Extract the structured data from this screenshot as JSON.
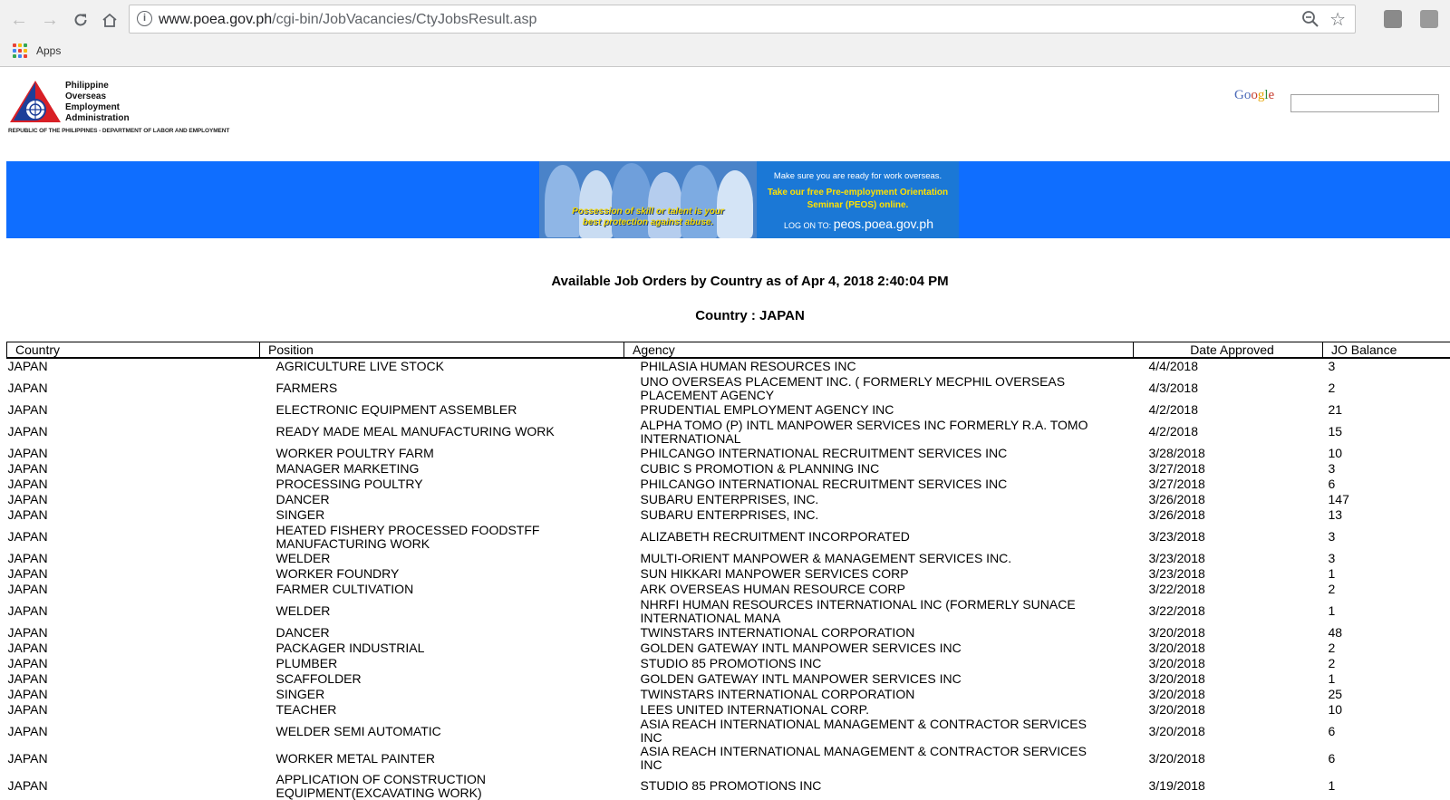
{
  "browser": {
    "url_host": "www.poea.gov.ph",
    "url_path": "/cgi-bin/JobVacancies/CtyJobsResult.asp",
    "bookmarks": [
      {
        "label": "Apps"
      }
    ]
  },
  "header": {
    "logo_lines": [
      "Philippine",
      "Overseas",
      "Employment",
      "Administration"
    ],
    "logo_subtitle": "REPUBLIC OF THE PHILIPPINES - DEPARTMENT OF LABOR AND EMPLOYMENT",
    "search_label": "Google",
    "search_value": ""
  },
  "banner": {
    "caption": "Possession of skill or talent is your best protection against abuse.",
    "line1": "Make sure you are ready for work overseas.",
    "line2": "Take our free Pre-employment Orientation Seminar (PEOS) online.",
    "logon_prefix": "LOG ON TO:",
    "logon_site": "peos.poea.gov.ph"
  },
  "page": {
    "title": "Available Job Orders by Country as of Apr 4, 2018 2:40:04 PM",
    "country_heading": "Country : JAPAN"
  },
  "table": {
    "headers": [
      "Country",
      "Position",
      "Agency",
      "Date Approved",
      "JO Balance"
    ],
    "rows": [
      {
        "country": "JAPAN",
        "position": "AGRICULTURE LIVE STOCK",
        "agency": "PHILASIA HUMAN RESOURCES INC",
        "date": "4/4/2018",
        "balance": "3"
      },
      {
        "country": "JAPAN",
        "position": "FARMERS",
        "agency": "UNO OVERSEAS PLACEMENT INC. ( FORMERLY MECPHIL OVERSEAS PLACEMENT AGENCY",
        "date": "4/3/2018",
        "balance": "2"
      },
      {
        "country": "JAPAN",
        "position": "ELECTRONIC EQUIPMENT ASSEMBLER",
        "agency": "PRUDENTIAL EMPLOYMENT AGENCY INC",
        "date": "4/2/2018",
        "balance": "21"
      },
      {
        "country": "JAPAN",
        "position": "READY MADE MEAL MANUFACTURING WORK",
        "agency": "ALPHA TOMO (P) INTL MANPOWER SERVICES INC FORMERLY R.A. TOMO INTERNATIONAL",
        "date": "4/2/2018",
        "balance": "15"
      },
      {
        "country": "JAPAN",
        "position": "WORKER POULTRY FARM",
        "agency": "PHILCANGO INTERNATIONAL RECRUITMENT SERVICES INC",
        "date": "3/28/2018",
        "balance": "10"
      },
      {
        "country": "JAPAN",
        "position": "MANAGER MARKETING",
        "agency": "CUBIC S PROMOTION & PLANNING INC",
        "date": "3/27/2018",
        "balance": "3"
      },
      {
        "country": "JAPAN",
        "position": "PROCESSING POULTRY",
        "agency": "PHILCANGO INTERNATIONAL RECRUITMENT SERVICES INC",
        "date": "3/27/2018",
        "balance": "6"
      },
      {
        "country": "JAPAN",
        "position": "DANCER",
        "agency": "SUBARU ENTERPRISES, INC.",
        "date": "3/26/2018",
        "balance": "147"
      },
      {
        "country": "JAPAN",
        "position": "SINGER",
        "agency": "SUBARU ENTERPRISES, INC.",
        "date": "3/26/2018",
        "balance": "13"
      },
      {
        "country": "JAPAN",
        "position": "HEATED FISHERY PROCESSED FOODSTFF MANUFACTURING WORK",
        "agency": "ALIZABETH RECRUITMENT INCORPORATED",
        "date": "3/23/2018",
        "balance": "3"
      },
      {
        "country": "JAPAN",
        "position": "WELDER",
        "agency": "MULTI-ORIENT MANPOWER & MANAGEMENT SERVICES INC.",
        "date": "3/23/2018",
        "balance": "3"
      },
      {
        "country": "JAPAN",
        "position": "WORKER FOUNDRY",
        "agency": "SUN HIKKARI MANPOWER SERVICES CORP",
        "date": "3/23/2018",
        "balance": "1"
      },
      {
        "country": "JAPAN",
        "position": "FARMER CULTIVATION",
        "agency": "ARK OVERSEAS HUMAN RESOURCE CORP",
        "date": "3/22/2018",
        "balance": "2"
      },
      {
        "country": "JAPAN",
        "position": "WELDER",
        "agency": "NHRFI HUMAN RESOURCES INTERNATIONAL INC (FORMERLY SUNACE INTERNATIONAL MANA",
        "date": "3/22/2018",
        "balance": "1"
      },
      {
        "country": "JAPAN",
        "position": "DANCER",
        "agency": "TWINSTARS INTERNATIONAL CORPORATION",
        "date": "3/20/2018",
        "balance": "48"
      },
      {
        "country": "JAPAN",
        "position": "PACKAGER INDUSTRIAL",
        "agency": "GOLDEN GATEWAY INTL MANPOWER SERVICES INC",
        "date": "3/20/2018",
        "balance": "2"
      },
      {
        "country": "JAPAN",
        "position": "PLUMBER",
        "agency": "STUDIO 85 PROMOTIONS INC",
        "date": "3/20/2018",
        "balance": "2"
      },
      {
        "country": "JAPAN",
        "position": "SCAFFOLDER",
        "agency": "GOLDEN GATEWAY INTL MANPOWER SERVICES INC",
        "date": "3/20/2018",
        "balance": "1"
      },
      {
        "country": "JAPAN",
        "position": "SINGER",
        "agency": "TWINSTARS INTERNATIONAL CORPORATION",
        "date": "3/20/2018",
        "balance": "25"
      },
      {
        "country": "JAPAN",
        "position": "TEACHER",
        "agency": "LEES UNITED INTERNATIONAL CORP.",
        "date": "3/20/2018",
        "balance": "10"
      },
      {
        "country": "JAPAN",
        "position": "WELDER SEMI AUTOMATIC",
        "agency": "ASIA REACH INTERNATIONAL MANAGEMENT & CONTRACTOR SERVICES INC",
        "date": "3/20/2018",
        "balance": "6"
      },
      {
        "country": "JAPAN",
        "position": "WORKER METAL PAINTER",
        "agency": "ASIA REACH INTERNATIONAL MANAGEMENT & CONTRACTOR SERVICES INC",
        "date": "3/20/2018",
        "balance": "6"
      },
      {
        "country": "JAPAN",
        "position": "APPLICATION OF CONSTRUCTION EQUIPMENT(EXCAVATING WORK)",
        "agency": "STUDIO 85 PROMOTIONS INC",
        "date": "3/19/2018",
        "balance": "1"
      }
    ]
  }
}
